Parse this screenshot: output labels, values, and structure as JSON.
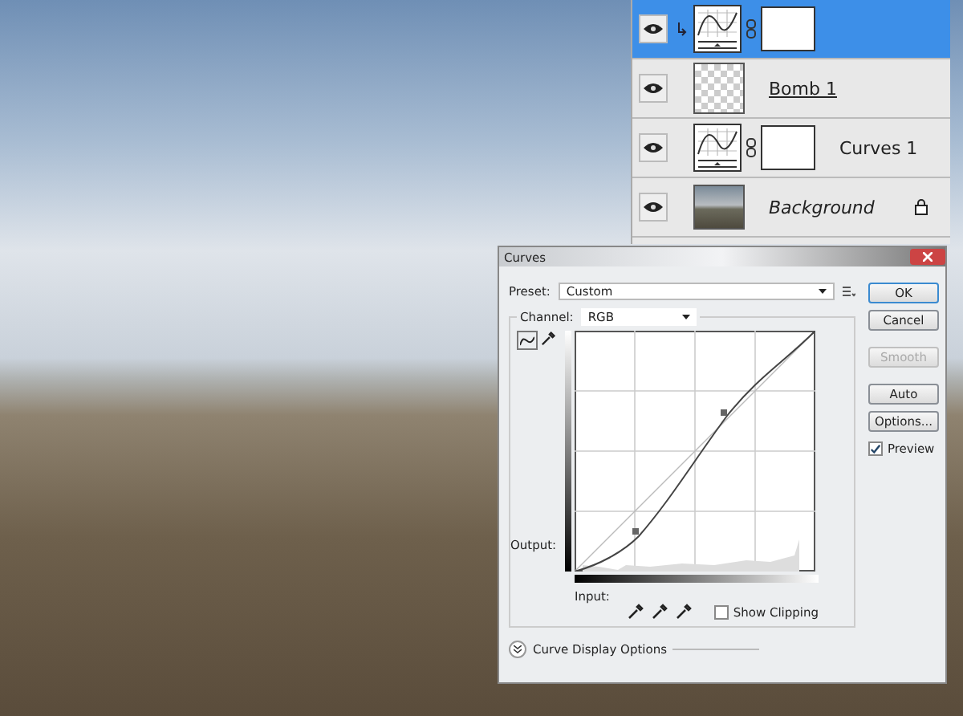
{
  "layers_panel": {
    "layers": [
      {
        "kind": "adjustment",
        "visible": true,
        "selected": true,
        "clipped": true,
        "locked": false,
        "underlined": false
      },
      {
        "kind": "pixel",
        "name": "Bomb 1",
        "visible": true,
        "selected": false,
        "clipped": false,
        "locked": false,
        "underlined": true
      },
      {
        "kind": "adjustment",
        "name": "Curves 1",
        "visible": true,
        "selected": false,
        "clipped": false,
        "locked": false,
        "underlined": false
      },
      {
        "kind": "background",
        "name": "Background",
        "visible": true,
        "selected": false,
        "clipped": false,
        "locked": true,
        "underlined": false
      }
    ]
  },
  "curves_dialog": {
    "title": "Curves",
    "preset_label": "Preset:",
    "preset": "Custom",
    "channel_label": "Channel:",
    "channel": "RGB",
    "buttons": [
      {
        "label": "OK",
        "disabled": false,
        "default": true
      },
      {
        "label": "Cancel",
        "disabled": false,
        "default": false
      },
      {
        "label": "Smooth",
        "disabled": true,
        "default": false
      },
      {
        "label": "Auto",
        "disabled": false,
        "default": false
      },
      {
        "label": "Options...",
        "disabled": false,
        "default": false
      }
    ],
    "preview": {
      "label": "Preview",
      "checked": true
    },
    "output_label": "Output:",
    "input_label": "Input:",
    "show_clipping": {
      "label": "Show Clipping",
      "checked": false
    },
    "display_options": "Curve Display Options"
  }
}
